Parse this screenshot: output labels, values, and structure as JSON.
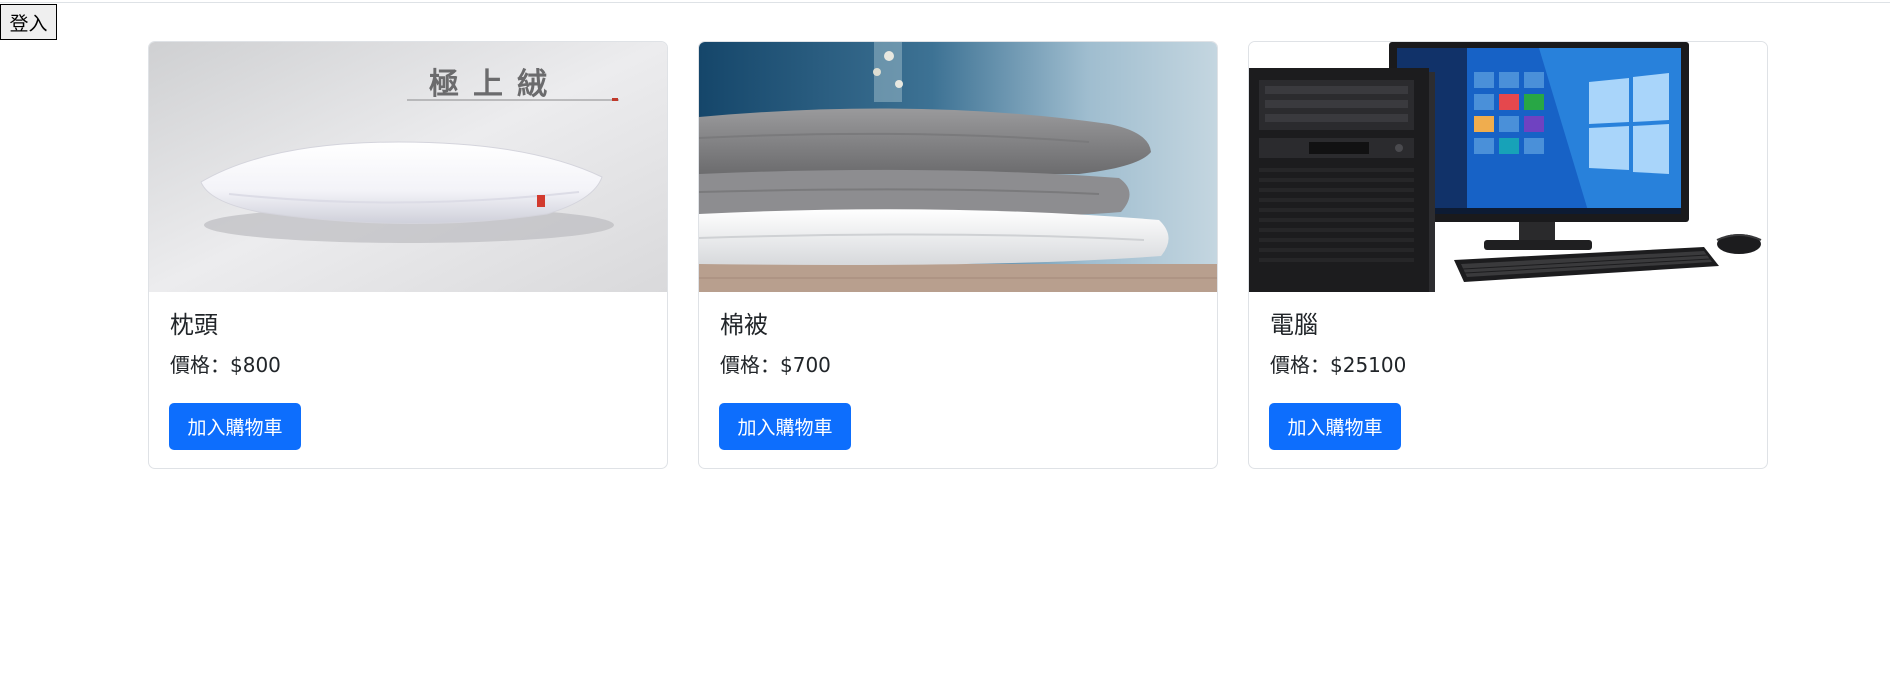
{
  "header": {
    "login_label": "登入"
  },
  "products": [
    {
      "name": "枕頭",
      "price": "價格：$800",
      "button_label": "加入購物車",
      "image_text": "極上絨"
    },
    {
      "name": "棉被",
      "price": "價格：$700",
      "button_label": "加入購物車"
    },
    {
      "name": "電腦",
      "price": "價格：$25100",
      "button_label": "加入購物車"
    }
  ],
  "colors": {
    "primary": "#0d6efd",
    "text": "#212529",
    "border": "#dfe2e6"
  }
}
